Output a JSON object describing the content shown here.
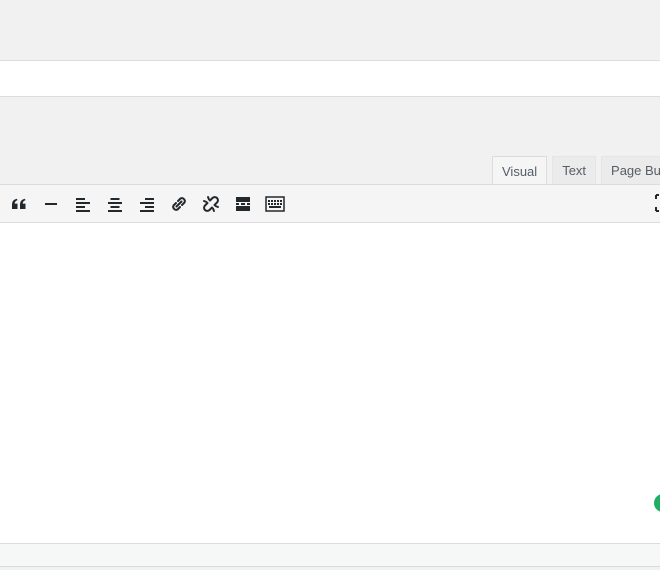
{
  "editor": {
    "tabs": [
      {
        "label": "Visual",
        "active": true
      },
      {
        "label": "Text",
        "active": false
      },
      {
        "label": "Page Buil",
        "active": false
      }
    ],
    "toolbar_icons": [
      "blockquote-icon",
      "horizontal-line-icon",
      "align-left-icon",
      "align-center-icon",
      "align-right-icon",
      "insert-link-icon",
      "remove-link-icon",
      "read-more-icon",
      "toolbar-toggle-icon"
    ],
    "content": ""
  },
  "colors": {
    "page_background": "#f1f1f1",
    "toolbar_background": "#f5f5f5",
    "icon": "#23282d",
    "green_indicator": "#1fae62"
  }
}
